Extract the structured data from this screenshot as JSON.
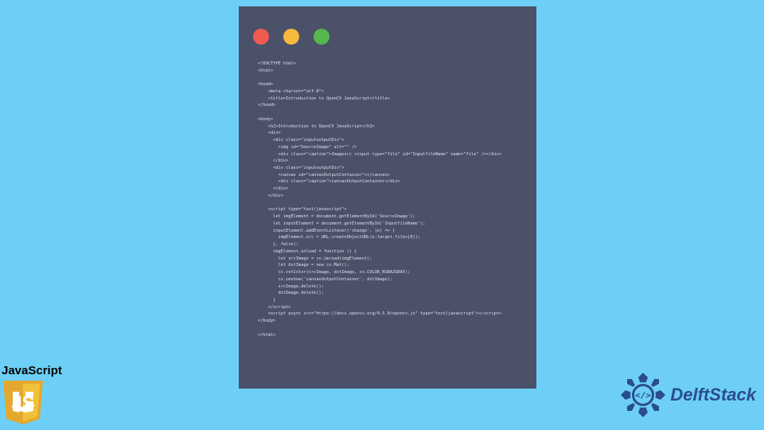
{
  "code_window": {
    "lines": [
      "<!DOCTYPE html>",
      "<html>",
      "",
      "<head>",
      "    <meta charset=\"utf-8\">",
      "    <title>Introduction to OpenCV JavaScript</title>",
      "</head>",
      "",
      "<body>",
      "    <h2>Introduction to OpenCV JavaScript</h2>",
      "    <div>",
      "      <div class=\"inputoutputDiv\">",
      "        <img id=\"SourceImage\" alt=\"\" />",
      "        <div class=\"caption\">Imagesrc <input type=\"file\" id=\"InputfileName\" name=\"file\" /></div>",
      "      </div>",
      "      <div class=\"inputoutputDiv\">",
      "        <canvas id=\"canvasOutputContainer\"></canvas>",
      "        <div class=\"caption\">canvasOutputContainer</div>",
      "      </div>",
      "    </div>",
      "",
      "    <script type=\"text/javascript\">",
      "      let imgElement = document.getElementById('SourceImage');",
      "      let inputElement = document.getElementById('InputfileName');",
      "      inputElement.addEventListener('change', (e) => {",
      "        imgElement.src = URL.createObjectURL(e.target.files[0]);",
      "      }, false);",
      "      imgElement.onload = function () {",
      "        let srcImage = cv.imread(imgElement);",
      "        let dstImage = new cv.Mat();",
      "        cv.cvtColor(srcImage, dstImage, cv.COLOR_RGBA2GRAY);",
      "        cv.imshow('canvasOutputContainer', dstImage);",
      "        srcImage.delete();",
      "        dstImage.delete();",
      "      }",
      "    </script>",
      "    <script async src=\"https://docs.opencv.org/4.5.0/opencv.js\" type=\"text/javascript\"></script>",
      "</body>",
      "",
      "</html>"
    ]
  },
  "js_logo": {
    "label": "JavaScript"
  },
  "delft": {
    "text": "DelftStack"
  }
}
